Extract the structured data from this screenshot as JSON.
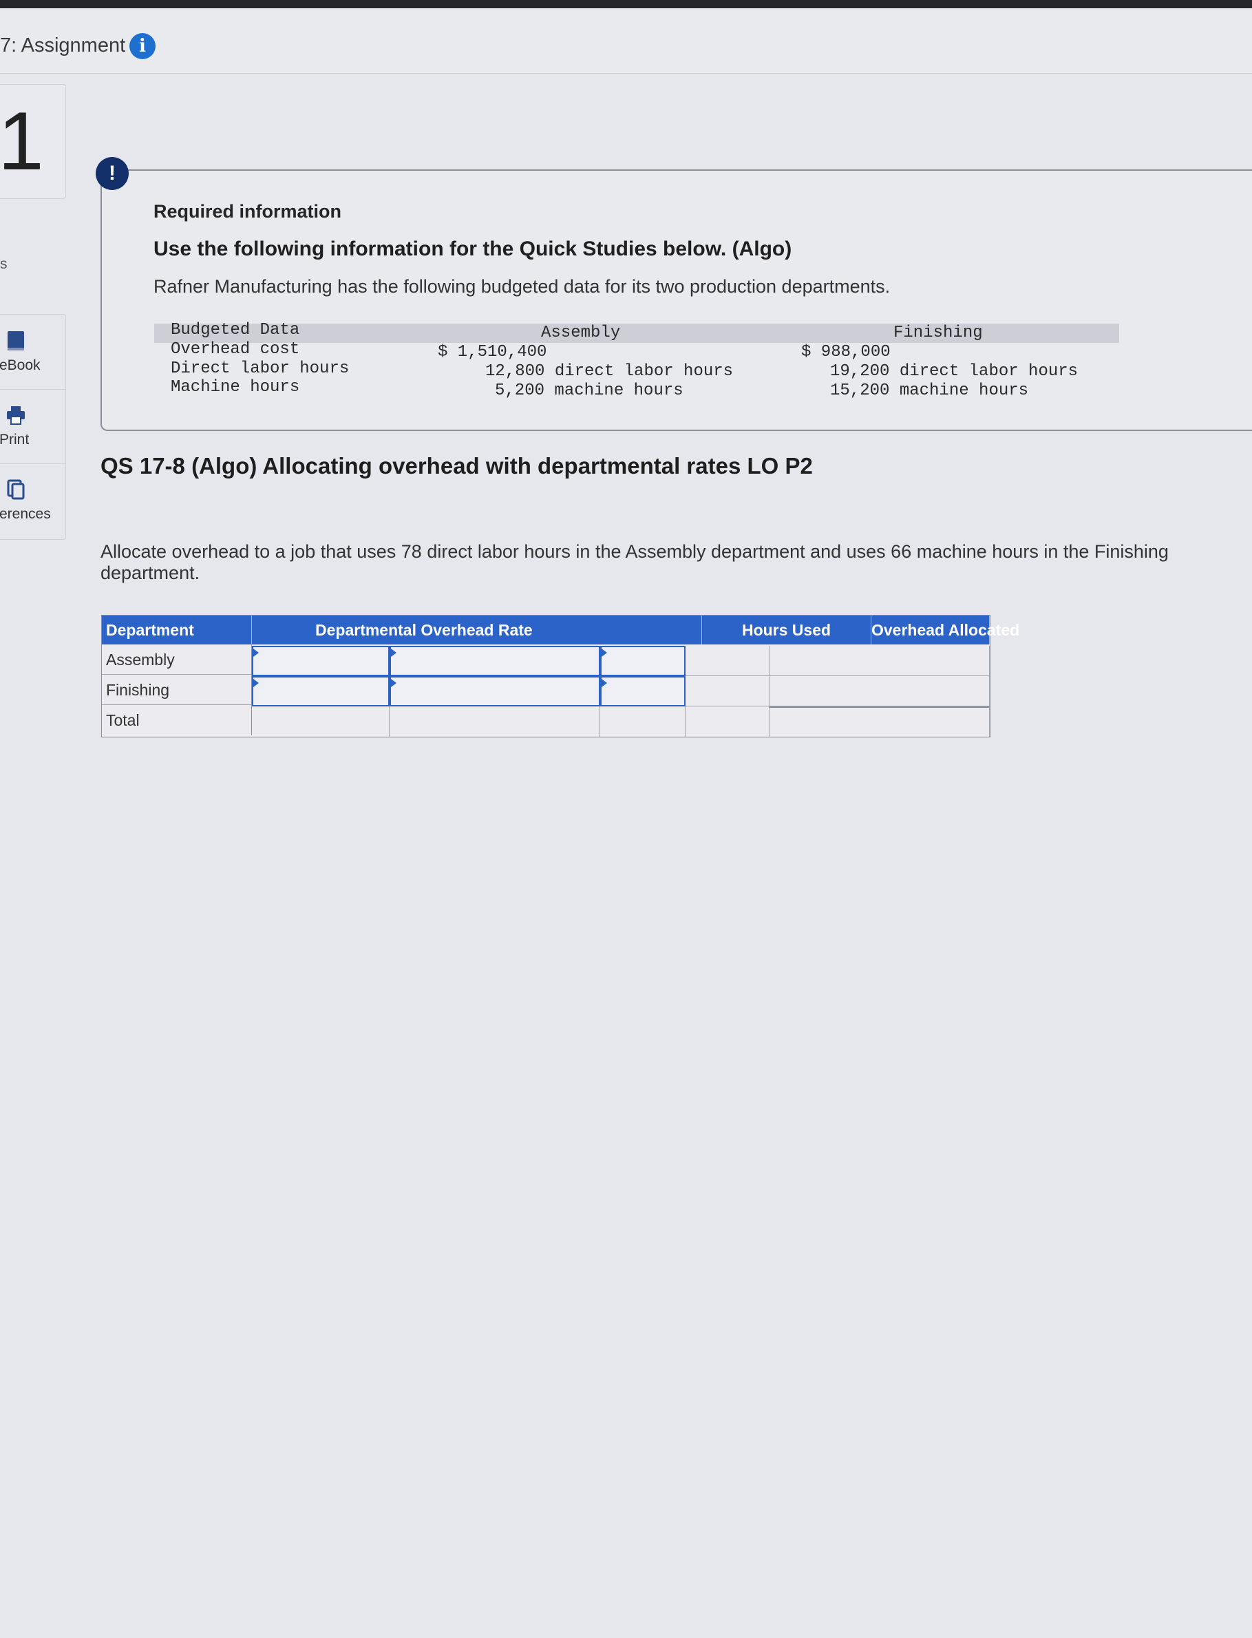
{
  "header": {
    "title": "7: Assignment"
  },
  "question_number": "1",
  "sidebar": {
    "truncated_label": "s",
    "items": [
      {
        "label": "eBook",
        "icon": "book-icon"
      },
      {
        "label": "Print",
        "icon": "printer-icon"
      },
      {
        "label": "erences",
        "icon": "references-icon"
      }
    ]
  },
  "required_info": {
    "heading": "Required information",
    "subheading": "Use the following information for the Quick Studies below. (Algo)",
    "description": "Rafner Manufacturing has the following budgeted data for its two production departments.",
    "table": {
      "col_label": "Budgeted Data",
      "col_assembly": "Assembly",
      "col_finishing": "Finishing",
      "rows": [
        {
          "label": "Overhead cost",
          "assembly": "$ 1,510,400",
          "finishing": "$ 988,000"
        },
        {
          "label": "Direct labor hours",
          "assembly": "12,800 direct labor hours",
          "finishing": "19,200 direct labor hours"
        },
        {
          "label": "Machine hours",
          "assembly": "5,200 machine hours",
          "finishing": "15,200 machine hours"
        }
      ]
    }
  },
  "question": {
    "title": "QS 17-8 (Algo) Allocating overhead with departmental rates LO P2",
    "instruction": "Allocate overhead to a job that uses 78 direct labor hours in the Assembly department and uses 66 machine hours in the Finishing department."
  },
  "answer_table": {
    "headers": [
      "Department",
      "Departmental Overhead Rate",
      "Hours Used",
      "Overhead Allocated"
    ],
    "rows": [
      "Assembly",
      "Finishing",
      "Total"
    ]
  },
  "colors": {
    "header_blue": "#2c63c8",
    "alert_navy": "#13306b",
    "info_blue": "#1f6fd1"
  }
}
